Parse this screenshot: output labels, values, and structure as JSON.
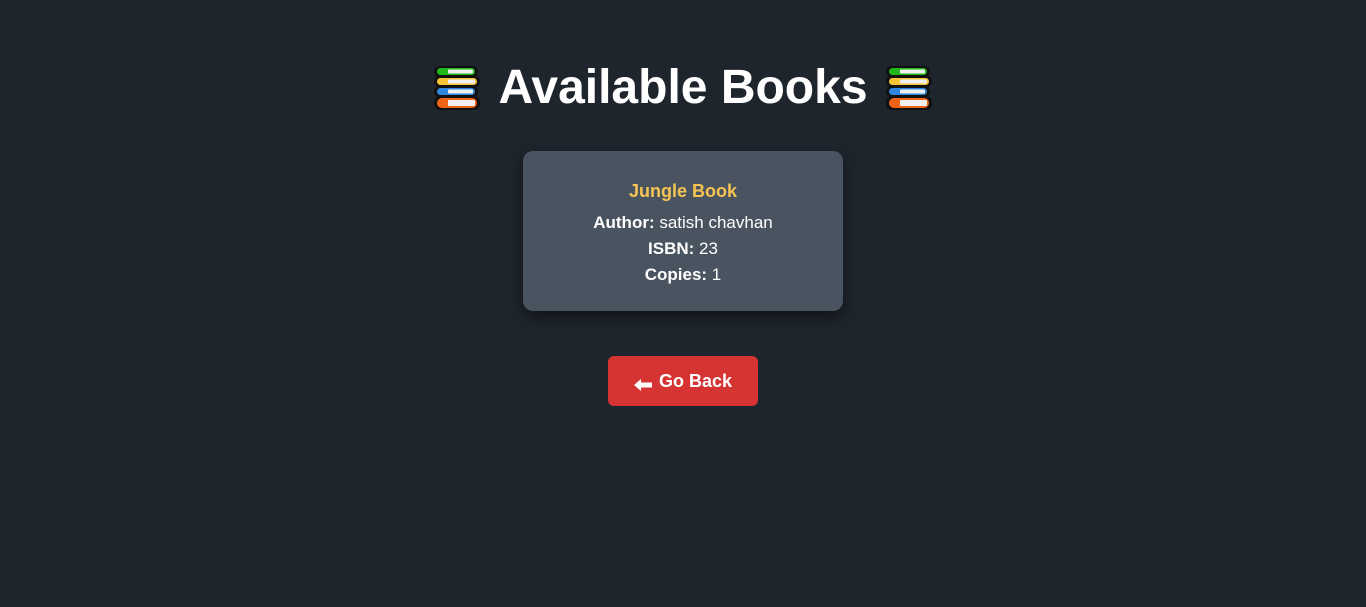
{
  "header": {
    "title": "Available Books",
    "left_icon": "books-stack-icon",
    "right_icon": "books-stack-icon"
  },
  "book": {
    "title": "Jungle Book",
    "author_label": "Author:",
    "author": "satish chavhan",
    "isbn_label": "ISBN:",
    "isbn": "23",
    "copies_label": "Copies:",
    "copies": "1"
  },
  "actions": {
    "go_back_label": "Go Back",
    "go_back_icon": "left-arrow-icon"
  },
  "colors": {
    "background": "#1f252d",
    "card": "#4a5460",
    "book_title": "#f6c453",
    "button": "#d63333"
  }
}
